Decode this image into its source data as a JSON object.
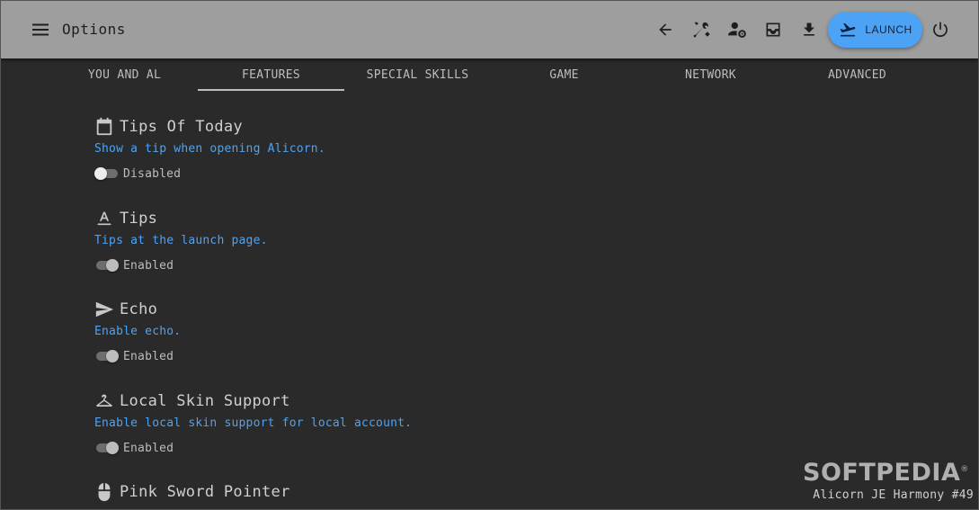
{
  "appbar": {
    "title": "Options",
    "launch_label": "LAUNCH",
    "actions": [
      "back-icon",
      "tools-icon",
      "account-settings-icon",
      "inbox-icon",
      "download-icon",
      "power-icon"
    ]
  },
  "tabs": [
    {
      "label": "YOU AND AL",
      "active": false
    },
    {
      "label": "FEATURES",
      "active": true
    },
    {
      "label": "SPECIAL SKILLS",
      "active": false
    },
    {
      "label": "GAME",
      "active": false
    },
    {
      "label": "NETWORK",
      "active": false
    },
    {
      "label": "ADVANCED",
      "active": false
    }
  ],
  "sections": [
    {
      "icon": "calendar-icon",
      "title": "Tips Of Today",
      "desc": "Show a tip when opening Alicorn.",
      "state": "Disabled"
    },
    {
      "icon": "format-text-icon",
      "title": "Tips",
      "desc": "Tips at the launch page.",
      "state": "Enabled"
    },
    {
      "icon": "send-icon",
      "title": "Echo",
      "desc": "Enable echo.",
      "state": "Enabled"
    },
    {
      "icon": "hanger-icon",
      "title": "Local Skin Support",
      "desc": "Enable local skin support for local account.",
      "state": "Enabled"
    },
    {
      "icon": "mouse-icon",
      "title": "Pink Sword Pointer"
    }
  ],
  "watermark": {
    "text": "SOFTPEDIA",
    "mark": "®"
  },
  "version": "Alicorn JE Harmony #49",
  "colors": {
    "appbar": "#9e9e9e",
    "accent": "#4ca3f5",
    "background": "#2a2a2a"
  }
}
